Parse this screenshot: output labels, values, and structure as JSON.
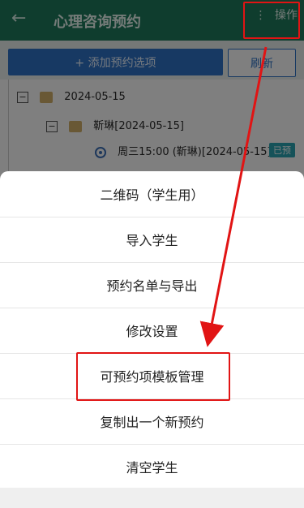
{
  "header": {
    "title": "心理咨询预约",
    "back_icon": "←",
    "ops_label": "操作",
    "ops_icon": "⋮"
  },
  "toolbar": {
    "add_label": "+ 添加预约选项",
    "refresh_label": "刷新"
  },
  "tree": {
    "date_root": "2024-05-15",
    "subfolder": "靳琳[2024-05-15]",
    "slot": "周三15:00 (靳琳)[2024-05-15]",
    "badge": "已预"
  },
  "sheet": {
    "items": [
      "二维码（学生用）",
      "导入学生",
      "预约名单与导出",
      "修改设置",
      "可预约项模板管理",
      "复制出一个新预约",
      "清空学生"
    ]
  },
  "colors": {
    "header_bg": "#1f7a5c",
    "primary_button": "#2f73c6",
    "highlight_red": "#e11414",
    "badge_teal": "#2aa5b3"
  }
}
